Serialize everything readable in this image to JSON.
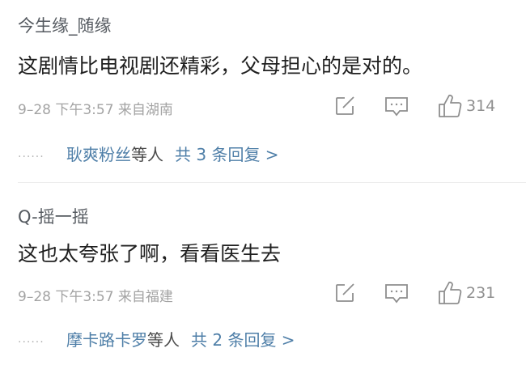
{
  "comments": [
    {
      "username": "今生缘_随缘",
      "content": "这剧情比电视剧还精彩，父母担心的是对的。",
      "meta": "9–28 下午3:57 来自湖南",
      "likes": "314",
      "reply_names": "耿爽粉丝",
      "reply_suffix": "等人",
      "reply_total": "共 3 条回复 >"
    },
    {
      "username": "Q-摇一摇",
      "content": "这也太夸张了啊，看看医生去",
      "meta": "9–28 下午3:57 来自福建",
      "likes": "231",
      "reply_names": "摩卡路卡罗",
      "reply_suffix": "等人",
      "reply_total": "共 2 条回复 >"
    }
  ],
  "icons": [
    "share-icon",
    "comment-icon",
    "like-icon"
  ]
}
